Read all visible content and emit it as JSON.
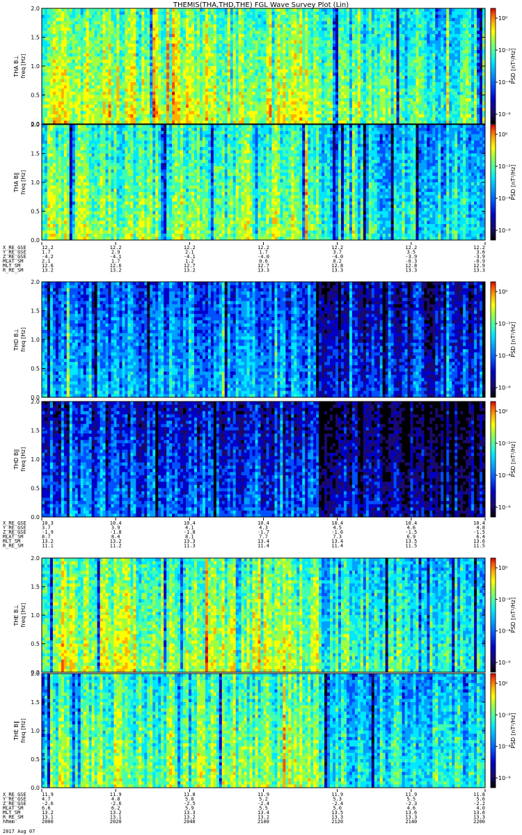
{
  "title": "THEMIS(THA,THD,THE) FGL Wave Survey Plot (Lin)",
  "colors": {
    "colormap": [
      "#000000",
      "#1a0a6e",
      "#0000c8",
      "#0050ff",
      "#00a0ff",
      "#00e8ff",
      "#40ffb0",
      "#a0ff40",
      "#ffff00",
      "#ffb000",
      "#ff5000",
      "#d00000"
    ]
  },
  "chart_data": [
    {
      "type": "heatmap",
      "panel": "THA B_L",
      "ylabel": [
        "THA B⊥",
        "freq [Hz]"
      ],
      "ylim": [
        0,
        2
      ],
      "yticks": [
        "0.0",
        "0.5",
        "1.0",
        "1.5",
        "2.0"
      ],
      "cbar_label": "PSD [nT²/Hz]",
      "cbar_ticks": [
        "10⁰",
        "10⁻²",
        "10⁻⁴",
        "10⁻⁶"
      ],
      "level": 0.62
    },
    {
      "type": "heatmap",
      "panel": "THA B_par",
      "ylabel": [
        "THA B∥",
        "freq [Hz]"
      ],
      "ylim": [
        0,
        2
      ],
      "yticks": [
        "0.0",
        "0.5",
        "1.0",
        "1.5",
        "2.0"
      ],
      "cbar_label": "PSD [nT²/Hz]",
      "cbar_ticks": [
        "10⁰",
        "10⁻²",
        "10⁻⁴",
        "10⁻⁶"
      ],
      "level": 0.56
    },
    {
      "type": "heatmap",
      "panel": "THD B_L",
      "ylabel": [
        "THD B⊥",
        "freq [Hz]"
      ],
      "ylim": [
        0,
        2
      ],
      "yticks": [
        "0.0",
        "0.5",
        "1.0",
        "1.5",
        "2.0"
      ],
      "cbar_label": "PSD [nT²/Hz]",
      "cbar_ticks": [
        "10⁰",
        "10⁻²",
        "10⁻⁴",
        "10⁻⁶"
      ],
      "level": 0.34
    },
    {
      "type": "heatmap",
      "panel": "THD B_par",
      "ylabel": [
        "THD B∥",
        "freq [Hz]"
      ],
      "ylim": [
        0,
        2
      ],
      "yticks": [
        "0.0",
        "0.5",
        "1.0",
        "1.5",
        "2.0"
      ],
      "cbar_label": "PSD [nT²/Hz]",
      "cbar_ticks": [
        "10⁰",
        "10⁻²",
        "10⁻⁴",
        "10⁻⁶"
      ],
      "level": 0.26
    },
    {
      "type": "heatmap",
      "panel": "THE B_L",
      "ylabel": [
        "THE B⊥",
        "freq [Hz]"
      ],
      "ylim": [
        0,
        2
      ],
      "yticks": [
        "0.0",
        "0.5",
        "1.0",
        "1.5",
        "2.0"
      ],
      "cbar_label": "PSD [nT²/Hz]",
      "cbar_ticks": [
        "10⁰",
        "10⁻²",
        "10⁻⁴",
        "10⁻⁶"
      ],
      "level": 0.6
    },
    {
      "type": "heatmap",
      "panel": "THE B_par",
      "ylabel": [
        "THE B∥",
        "freq [Hz]"
      ],
      "ylim": [
        0,
        2
      ],
      "yticks": [
        "0.0",
        "0.5",
        "1.0",
        "1.5",
        "2.0"
      ],
      "cbar_label": "PSD [nT²/Hz]",
      "cbar_ticks": [
        "10⁰",
        "10⁻²",
        "10⁻⁴",
        "10⁻⁶"
      ],
      "level": 0.56
    }
  ],
  "ephemeris": [
    {
      "rows": [
        {
          "label": "X_RE_GSE",
          "values": [
            "12.2",
            "12.2",
            "12.2",
            "12.2",
            "12.2",
            "12.2",
            "12.2"
          ]
        },
        {
          "label": "Y_RE_GSE",
          "values": [
            "1.7",
            "2.9",
            "2.1",
            "1.7",
            "3.7",
            "3.5",
            "3.6"
          ]
        },
        {
          "label": "Z_RE_GSE",
          "values": [
            "-4.2",
            "-4.1",
            "-4.1",
            "-4.0",
            "-4.0",
            "-3.9",
            "-3.9"
          ]
        },
        {
          "label": "MLAT_SM",
          "values": [
            "2.1",
            "1.7",
            "1.2",
            "0.6",
            "0.2",
            "-0.3",
            "-0.9"
          ]
        },
        {
          "label": "MLT_SM",
          "values": [
            "12.6",
            "12.6",
            "12.7",
            "12.7",
            "12.8",
            "12.8",
            "12.9"
          ]
        },
        {
          "label": "R_RE_SM",
          "values": [
            "13.2",
            "13.2",
            "13.2",
            "13.3",
            "13.3",
            "13.3",
            "13.3"
          ]
        }
      ]
    },
    {
      "rows": [
        {
          "label": "X_RE_GSE",
          "values": [
            "10.3",
            "10.4",
            "10.4",
            "10.4",
            "10.4",
            "10.4",
            "10.4"
          ]
        },
        {
          "label": "Y_RE_GSE",
          "values": [
            "3.7",
            "3.9",
            "4.1",
            "4.3",
            "4.5",
            "4.6",
            "4.8"
          ]
        },
        {
          "label": "Z_RE_GSE",
          "values": [
            "-1.9",
            "-1.8",
            "-1.8",
            "-1.7",
            "-1.6",
            "-1.5",
            "-1.5"
          ]
        },
        {
          "label": "MLAT_SM",
          "values": [
            "8.7",
            "8.4",
            "8.1",
            "7.7",
            "7.3",
            "6.9",
            "6.4"
          ]
        },
        {
          "label": "MLT_SM",
          "values": [
            "13.2",
            "13.2",
            "13.3",
            "13.4",
            "13.4",
            "13.5",
            "13.6"
          ]
        },
        {
          "label": "R_RE_SM",
          "values": [
            "11.1",
            "11.2",
            "11.3",
            "11.4",
            "11.4",
            "11.5",
            "11.5"
          ]
        }
      ]
    },
    {
      "rows": [
        {
          "label": "X_RE_GSE",
          "values": [
            "11.9",
            "11.9",
            "11.8",
            "11.9",
            "11.9",
            "11.9",
            "11.8"
          ]
        },
        {
          "label": "Y_RE_GSE",
          "values": [
            "4.7",
            "4.8",
            "5.0",
            "5.2",
            "5.3",
            "5.5",
            "5.6"
          ]
        },
        {
          "label": "Z_RE_GSE",
          "values": [
            "-2.6",
            "-2.6",
            "-2.5",
            "-2.4",
            "-2.4",
            "-2.3",
            "-2.2"
          ]
        },
        {
          "label": "MLAT_SM",
          "values": [
            "6.6",
            "6.2",
            "5.9",
            "5.5",
            "5.0",
            "4.6",
            "4.0"
          ]
        },
        {
          "label": "MLT_SM",
          "values": [
            "13.2",
            "13.2",
            "13.3",
            "13.4",
            "13.5",
            "13.6",
            "13.6"
          ]
        },
        {
          "label": "R_RE_SM",
          "values": [
            "13.1",
            "13.1",
            "13.2",
            "13.2",
            "13.3",
            "13.3",
            "13.3"
          ]
        },
        {
          "label": "hhmm",
          "values": [
            "2000",
            "2020",
            "2040",
            "2100",
            "2120",
            "2140",
            "2200"
          ]
        }
      ]
    }
  ],
  "date_label": "2017 Aug 07"
}
